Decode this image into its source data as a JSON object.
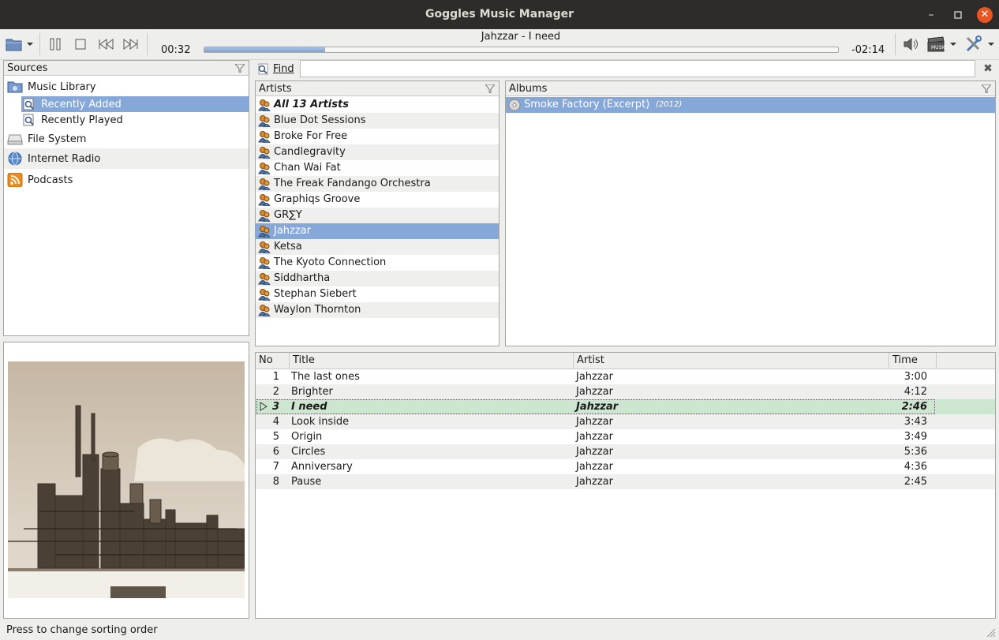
{
  "window": {
    "title": "Goggles Music Manager"
  },
  "player": {
    "now_playing": "Jahzzar - I need",
    "elapsed": "00:32",
    "remaining": "-02:14",
    "progress_fraction": 0.19
  },
  "sources": {
    "header": "Sources",
    "items": [
      {
        "label": "Music Library"
      },
      {
        "label": "Recently Added"
      },
      {
        "label": "Recently Played"
      },
      {
        "label": "File System"
      },
      {
        "label": "Internet Radio"
      },
      {
        "label": "Podcasts"
      }
    ]
  },
  "find": {
    "label": "Find",
    "value": ""
  },
  "artists": {
    "header": "Artists",
    "items": [
      "All 13 Artists",
      "Blue Dot Sessions",
      "Broke For Free",
      "Candlegravity",
      "Chan Wai Fat",
      "The Freak Fandango Orchestra",
      "Graphiqs Groove",
      "GR∑Y",
      "Jahzzar",
      "Ketsa",
      "The Kyoto Connection",
      "Siddhartha",
      "Stephan Siebert",
      "Waylon Thornton"
    ],
    "selected": "Jahzzar"
  },
  "albums": {
    "header": "Albums",
    "items": [
      {
        "title": "Smoke Factory (Excerpt)",
        "year": "(2012)"
      }
    ]
  },
  "tracks": {
    "columns": {
      "no": "No",
      "title": "Title",
      "artist": "Artist",
      "time": "Time"
    },
    "rows": [
      {
        "no": "1",
        "title": "The last ones",
        "artist": "Jahzzar",
        "time": "3:00"
      },
      {
        "no": "2",
        "title": "Brighter",
        "artist": "Jahzzar",
        "time": "4:12"
      },
      {
        "no": "3",
        "title": "I need",
        "artist": "Jahzzar",
        "time": "2:46"
      },
      {
        "no": "4",
        "title": "Look inside",
        "artist": "Jahzzar",
        "time": "3:43"
      },
      {
        "no": "5",
        "title": "Origin",
        "artist": "Jahzzar",
        "time": "3:49"
      },
      {
        "no": "6",
        "title": "Circles",
        "artist": "Jahzzar",
        "time": "5:36"
      },
      {
        "no": "7",
        "title": "Anniversary",
        "artist": "Jahzzar",
        "time": "4:36"
      },
      {
        "no": "8",
        "title": "Pause",
        "artist": "Jahzzar",
        "time": "2:45"
      }
    ],
    "playing_index": 2
  },
  "status": {
    "text": "Press to change sorting order"
  }
}
